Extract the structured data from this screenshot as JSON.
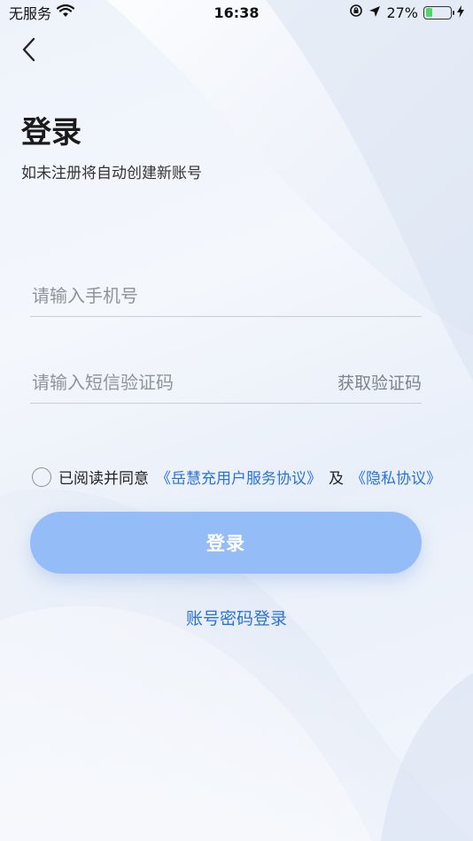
{
  "status_bar": {
    "carrier": "无服务",
    "time": "16:38",
    "battery": "27%",
    "battery_level": 0.27,
    "icons": [
      "wifi-icon",
      "rotation-lock-icon",
      "location-icon",
      "battery-icon",
      "charging-icon"
    ]
  },
  "header": {
    "back_icon": "chevron-left-icon",
    "title": "登录",
    "subtitle": "如未注册将自动创建新账号"
  },
  "form": {
    "phone_placeholder": "请输入手机号",
    "phone_value": "",
    "code_placeholder": "请输入短信验证码",
    "code_value": "",
    "get_code_label": "获取验证码"
  },
  "agreement": {
    "checked": false,
    "prefix": "已阅读并同意",
    "service_link": "《岳慧充用户服务协议》",
    "and": "及",
    "privacy_link": "《隐私协议》"
  },
  "actions": {
    "login_label": "登录",
    "password_login_label": "账号密码登录"
  },
  "colors": {
    "accent": "#2a72d6",
    "button": "#94bdf8",
    "background": "#eef3fb"
  }
}
